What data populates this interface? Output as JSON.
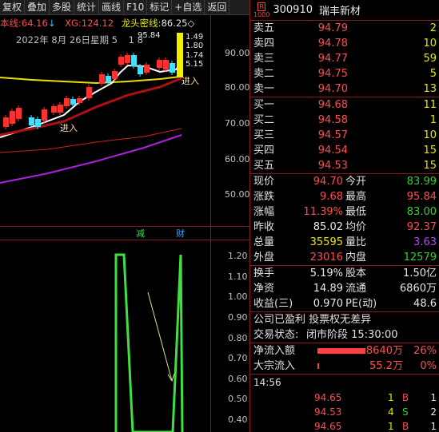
{
  "toolbar": {
    "buttons": [
      "复权",
      "叠加",
      "多股",
      "统计",
      "画线",
      "F10",
      "标记",
      "+自选",
      "返回"
    ]
  },
  "chart": {
    "indicators": {
      "ben_label": "本线:",
      "ben_value": "64.16",
      "ben_arrow": "↓",
      "xg_label": "XG:",
      "xg_value": "124.12",
      "ltmx_label": "龙头密线:",
      "ltmx_value": "86.25",
      "ltmx_icon": "◇"
    },
    "date_text": "2022年 8月 26日星期 5",
    "date_extra": "1 8",
    "price_labels": [
      "95.84",
      "1.49",
      "1.80",
      "1.74",
      "5.15"
    ],
    "price_axis": [
      "90.00",
      "80.00",
      "70.00",
      "60.00",
      "50.00"
    ],
    "signal_labels": [
      "进入",
      "进入"
    ],
    "event_labels": [
      "减",
      "财"
    ],
    "sub_axis": [
      "1.20",
      "1.10",
      "1.00",
      "0.90",
      "0.80",
      "0.70",
      "0.60",
      "0.50",
      "0.40"
    ],
    "colors": {
      "ma_yellow": "#e8e000",
      "ma_white": "#ffffff",
      "ma_darkred": "#b01010",
      "ma_red": "#d02020",
      "ma_purple": "#b020e0",
      "candle_up": "#ff3030",
      "candle_down": "#40e0ff",
      "osc": "#40e040"
    }
  },
  "panel": {
    "badge_top": "R",
    "badge_bottom": "1000",
    "code": "300910",
    "name": "瑞丰新材",
    "asks": [
      {
        "label": "卖五",
        "price": "94.79",
        "vol": "2"
      },
      {
        "label": "卖四",
        "price": "94.78",
        "vol": "10"
      },
      {
        "label": "卖三",
        "price": "94.77",
        "vol": "59"
      },
      {
        "label": "卖二",
        "price": "94.75",
        "vol": "5"
      },
      {
        "label": "卖一",
        "price": "94.70",
        "vol": "13"
      }
    ],
    "bids": [
      {
        "label": "买一",
        "price": "94.68",
        "vol": "11"
      },
      {
        "label": "买二",
        "price": "94.58",
        "vol": "1"
      },
      {
        "label": "买三",
        "price": "94.57",
        "vol": "10"
      },
      {
        "label": "买四",
        "price": "94.54",
        "vol": "15"
      },
      {
        "label": "买五",
        "price": "94.53",
        "vol": "15"
      }
    ],
    "quote": [
      {
        "a": "现价",
        "b": "94.70",
        "bc": "red",
        "c": "今开",
        "d": "83.99",
        "dc": "green"
      },
      {
        "a": "涨跌",
        "b": "9.68",
        "bc": "red",
        "c": "最高",
        "d": "95.84",
        "dc": "red"
      },
      {
        "a": "涨幅",
        "b": "11.39%",
        "bc": "red",
        "c": "最低",
        "d": "83.00",
        "dc": "green"
      },
      {
        "a": "昨收",
        "b": "85.02",
        "bc": "white",
        "c": "均价",
        "d": "92.37",
        "dc": "red"
      },
      {
        "a": "总量",
        "b": "35595",
        "bc": "yellow",
        "c": "量比",
        "d": "3.63",
        "dc": "purple"
      },
      {
        "a": "外盘",
        "b": "23016",
        "bc": "red",
        "c": "内盘",
        "d": "12579",
        "dc": "green"
      }
    ],
    "fundamentals": [
      {
        "a": "换手",
        "b": "5.19%",
        "c": "股本",
        "d": "1.50亿"
      },
      {
        "a": "净资",
        "b": "14.89",
        "c": "流通",
        "d": "6860万"
      },
      {
        "a": "收益(三)",
        "b": "0.970",
        "c": "PE(动)",
        "d": "48.6"
      }
    ],
    "info_line": "公司已盈利 投票权无差异",
    "status_label": "交易状态:",
    "status_value": "闭市阶段 15:30:00",
    "flows": [
      {
        "label": "净流入额",
        "value": "8640万",
        "pct": "26%",
        "bar": 0.26
      },
      {
        "label": "大宗流入",
        "value": "55.2万",
        "pct": "0%",
        "bar": 0.0
      }
    ],
    "trade_time": "14:56",
    "trades": [
      {
        "price": "94.65",
        "vol": "1",
        "bs": "B",
        "bsc": "red",
        "k": "1"
      },
      {
        "price": "94.53",
        "vol": "4",
        "bs": "S",
        "bsc": "green",
        "k": "2"
      },
      {
        "price": "94.65",
        "vol": "1",
        "bs": "B",
        "bsc": "red",
        "k": "1"
      }
    ]
  }
}
